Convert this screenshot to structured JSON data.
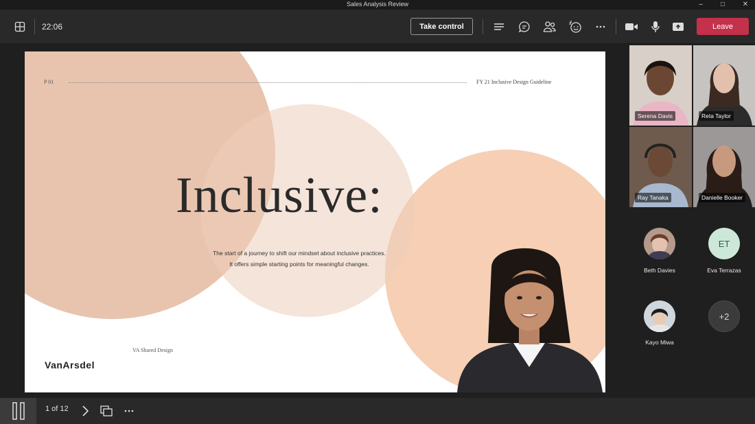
{
  "window": {
    "title": "Sales Analysis Review"
  },
  "toolbar": {
    "time": "22:06",
    "take_control_label": "Take control",
    "leave_label": "Leave"
  },
  "slide": {
    "page_marker": "P 01",
    "header_right": "FY 21 Inclusive Design Guideline",
    "headline": "Inclusive:",
    "subtitle_line1": "The start of a journey to shift our mindset about inclusive practices.",
    "subtitle_line2": "It offers simple starting points for meaningful changes.",
    "footer_label": "VA Shared Design",
    "logo_text": "VanArsdel"
  },
  "participants": {
    "video": [
      {
        "name": "Serena Davis"
      },
      {
        "name": "Reta Taylor"
      },
      {
        "name": "Ray Tanaka"
      },
      {
        "name": "Danielle Booker"
      }
    ],
    "audio": [
      {
        "name": "Beth Davies",
        "initials": ""
      },
      {
        "name": "Eva Terrazas",
        "initials": "ET"
      },
      {
        "name": "Kayo Miwa",
        "initials": ""
      },
      {
        "name": "",
        "initials": "+2"
      }
    ]
  },
  "bottombar": {
    "page_count": "1 of 12"
  },
  "colors": {
    "leave": "#c4314b",
    "accent_peach": "#f6cfb5",
    "eva_avatar": "#cde8d8"
  },
  "icons": [
    "grid-icon",
    "chat-list-icon",
    "chat-icon",
    "people-icon",
    "reactions-icon",
    "more-icon",
    "camera-icon",
    "mic-icon",
    "share-icon",
    "pause-icon",
    "chevron-right-icon",
    "slides-icon"
  ]
}
